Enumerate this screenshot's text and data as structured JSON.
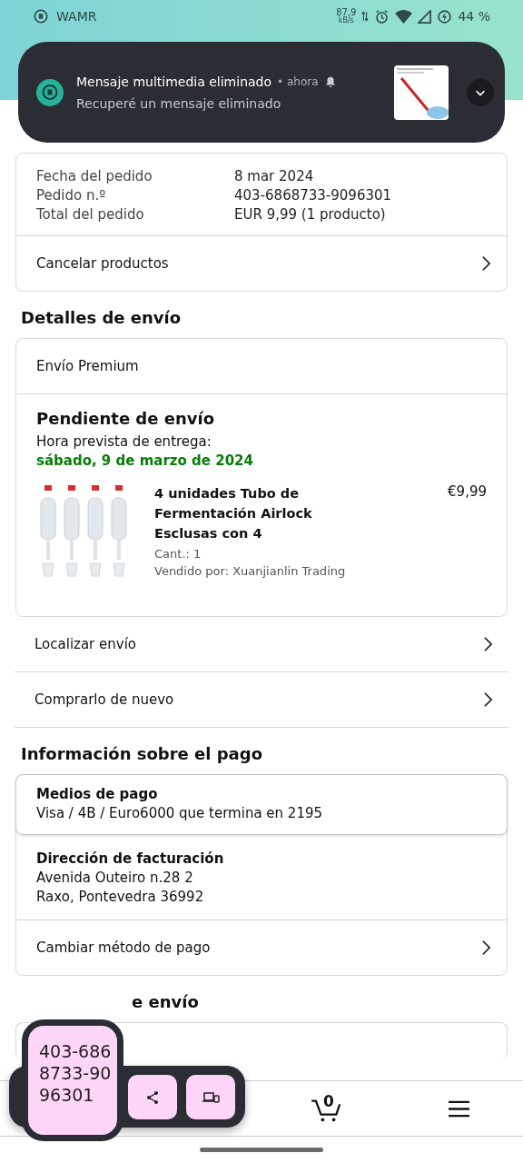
{
  "status_bar": {
    "app": "WAMR",
    "speed": "87,9",
    "speed_unit": "kB/s",
    "battery": "44 %"
  },
  "notification": {
    "title": "Mensaje multimedia eliminado",
    "time": "• ahora",
    "body": "Recuperé un mensaje eliminado"
  },
  "order": {
    "fields": [
      {
        "label": "Fecha del pedido",
        "value": "8 mar 2024"
      },
      {
        "label": "Pedido n.º",
        "value": "403-6868733-9096301"
      },
      {
        "label": "Total del pedido",
        "value": "EUR 9,99 (1 producto)"
      }
    ],
    "action": "Cancelar productos"
  },
  "shipping": {
    "heading": "Detalles de envío",
    "service": "Envío Premium",
    "status": "Pendiente de envío",
    "eta_label": "Hora prevista de entrega:",
    "eta": "sábado, 9 de marzo de 2024",
    "item": {
      "title": "4 unidades Tubo de Fermentación Airlock Esclusas con 4",
      "qty": "Cant.: 1",
      "seller": "Vendido por: Xuanjianlin Trading",
      "price": "€9,99"
    },
    "actions": [
      "Localizar envío",
      "Comprarlo de nuevo"
    ]
  },
  "payment": {
    "heading": "Información sobre el pago",
    "method_label": "Medios de pago",
    "method": "Visa / 4B / Euro6000  que termina en 2195",
    "billing_label": "Dirección de facturación",
    "billing_lines": [
      "Avenida Outeiro n.28 2",
      "Raxo, Pontevedra 36992"
    ],
    "action": "Cambiar método de pago"
  },
  "next_heading": "e envío",
  "clipboard": {
    "text": "403-686 8733-90 96301"
  },
  "bottom_nav": {
    "cart_count": "0"
  }
}
